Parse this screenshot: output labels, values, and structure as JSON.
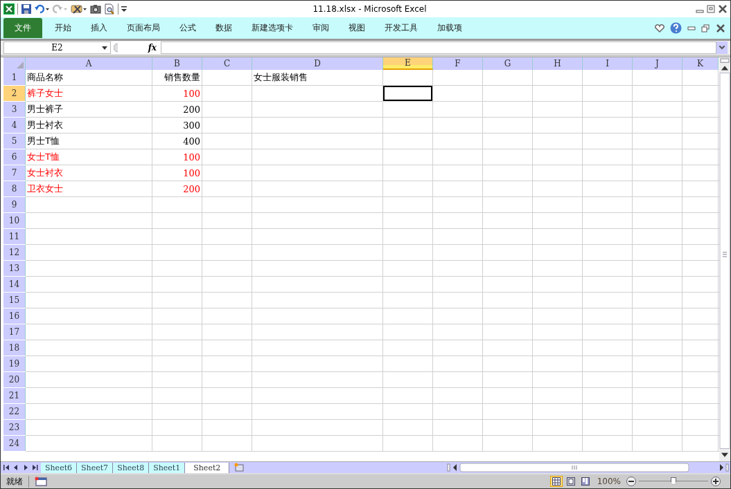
{
  "window": {
    "title": "11.18.xlsx - Microsoft Excel"
  },
  "ribbon_tabs": [
    {
      "label": "文件",
      "kind": "file",
      "selected": false
    },
    {
      "label": "开始",
      "kind": "tab",
      "selected": false
    },
    {
      "label": "插入",
      "kind": "tab",
      "selected": false
    },
    {
      "label": "页面布局",
      "kind": "tab",
      "selected": false
    },
    {
      "label": "公式",
      "kind": "tab",
      "selected": false
    },
    {
      "label": "数据",
      "kind": "tab",
      "selected": false
    },
    {
      "label": "新建选项卡",
      "kind": "tab",
      "selected": false
    },
    {
      "label": "审阅",
      "kind": "tab",
      "selected": false
    },
    {
      "label": "视图",
      "kind": "tab",
      "selected": false
    },
    {
      "label": "开发工具",
      "kind": "tab",
      "selected": false
    },
    {
      "label": "加载项",
      "kind": "tab",
      "selected": false
    }
  ],
  "formula_bar": {
    "name_box": "E2",
    "function_label": "fx"
  },
  "columns": [
    {
      "label": "A",
      "selected": false
    },
    {
      "label": "B",
      "selected": false
    },
    {
      "label": "C",
      "selected": false
    },
    {
      "label": "D",
      "selected": false
    },
    {
      "label": "E",
      "selected": true
    },
    {
      "label": "F",
      "selected": false
    },
    {
      "label": "G",
      "selected": false
    },
    {
      "label": "H",
      "selected": false
    },
    {
      "label": "I",
      "selected": false
    },
    {
      "label": "J",
      "selected": false
    },
    {
      "label": "K",
      "selected": false
    }
  ],
  "rows": [
    {
      "header": "1",
      "selected": false,
      "highlighted": false,
      "cells": [
        "商品名称",
        "销售数量",
        "",
        "女士服装销售"
      ]
    },
    {
      "header": "2",
      "selected": true,
      "highlighted": true,
      "cells": [
        "裤子女士",
        "100"
      ]
    },
    {
      "header": "3",
      "selected": false,
      "highlighted": false,
      "cells": [
        "男士裤子",
        "200"
      ]
    },
    {
      "header": "4",
      "selected": false,
      "highlighted": false,
      "cells": [
        "男士衬衣",
        "300"
      ]
    },
    {
      "header": "5",
      "selected": false,
      "highlighted": false,
      "cells": [
        "男士T恤",
        "400"
      ]
    },
    {
      "header": "6",
      "selected": false,
      "highlighted": true,
      "cells": [
        "女士T恤",
        "100"
      ]
    },
    {
      "header": "7",
      "selected": false,
      "highlighted": true,
      "cells": [
        "女士衬衣",
        "100"
      ]
    },
    {
      "header": "8",
      "selected": false,
      "highlighted": true,
      "cells": [
        "卫衣女士",
        "200"
      ]
    },
    {
      "header": "9",
      "selected": false
    },
    {
      "header": "10",
      "selected": false
    },
    {
      "header": "11",
      "selected": false
    },
    {
      "header": "12",
      "selected": false
    },
    {
      "header": "13",
      "selected": false
    },
    {
      "header": "14",
      "selected": false
    },
    {
      "header": "15",
      "selected": false
    },
    {
      "header": "16",
      "selected": false
    },
    {
      "header": "17",
      "selected": false
    },
    {
      "header": "18",
      "selected": false
    },
    {
      "header": "19",
      "selected": false
    },
    {
      "header": "20",
      "selected": false
    },
    {
      "header": "21",
      "selected": false
    },
    {
      "header": "22",
      "selected": false
    },
    {
      "header": "23",
      "selected": false
    },
    {
      "header": "24",
      "selected": false
    }
  ],
  "sheet_tabs": [
    {
      "label": "Sheet6",
      "selected": false
    },
    {
      "label": "Sheet7",
      "selected": false
    },
    {
      "label": "Sheet8",
      "selected": false
    },
    {
      "label": "Sheet1",
      "selected": false
    },
    {
      "label": "Sheet2",
      "selected": true
    }
  ],
  "status_bar": {
    "status": "就绪",
    "views": [
      {
        "kind": "normal",
        "selected": true
      },
      {
        "kind": "layout",
        "selected": false
      },
      {
        "kind": "pagebreak",
        "selected": false
      }
    ],
    "zoom": "100%",
    "zoom_slider": {
      "level": 0.5
    }
  }
}
